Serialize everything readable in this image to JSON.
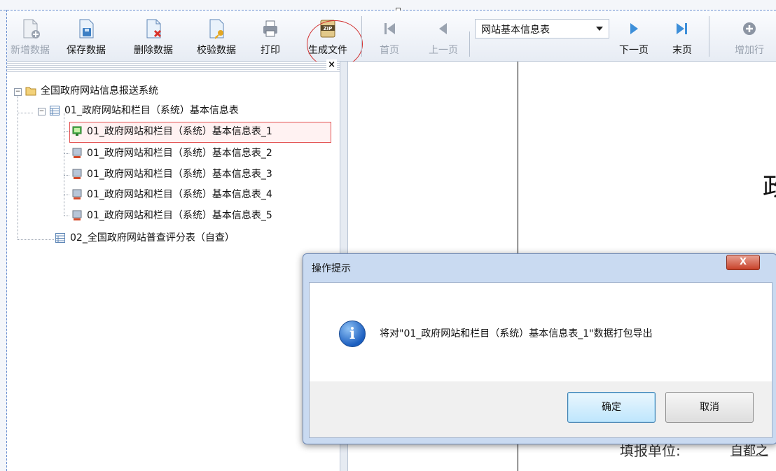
{
  "toolbar": {
    "add_label": "新增数据",
    "save_label": "保存数据",
    "delete_label": "删除数据",
    "verify_label": "校验数据",
    "print_label": "打印",
    "generate_label": "生成文件",
    "first_label": "首页",
    "prev_label": "上一页",
    "page_select_value": "网站基本信息表",
    "next_label": "下一页",
    "last_label": "末页",
    "add_row_label": "增加行",
    "zip_badge": "ZIP"
  },
  "panel": {
    "close_label": "×"
  },
  "tree": {
    "root": {
      "label": "全国政府网站信息报送系统",
      "expander": "−"
    },
    "group1": {
      "label": "01_政府网站和栏目（系统）基本信息表",
      "expander": "−",
      "items": [
        "01_政府网站和栏目（系统）基本信息表_1",
        "01_政府网站和栏目（系统）基本信息表_2",
        "01_政府网站和栏目（系统）基本信息表_3",
        "01_政府网站和栏目（系统）基本信息表_4",
        "01_政府网站和栏目（系统）基本信息表_5"
      ]
    },
    "group2": {
      "label": "02_全国政府网站普查评分表（自查）"
    }
  },
  "document": {
    "partial_char": "政",
    "label": "填报单位:",
    "value": "自都之"
  },
  "dialog": {
    "title": "操作提示",
    "close_label": "X",
    "info_glyph": "i",
    "message": "将对\"01_政府网站和栏目（系统）基本信息表_1\"数据打包导出",
    "ok_label": "确定",
    "cancel_label": "取消"
  },
  "colors": {
    "accent": "#2f74c0",
    "selected_border": "#e35252",
    "circle": "#d12d2d",
    "close_button": "#c8422a"
  }
}
